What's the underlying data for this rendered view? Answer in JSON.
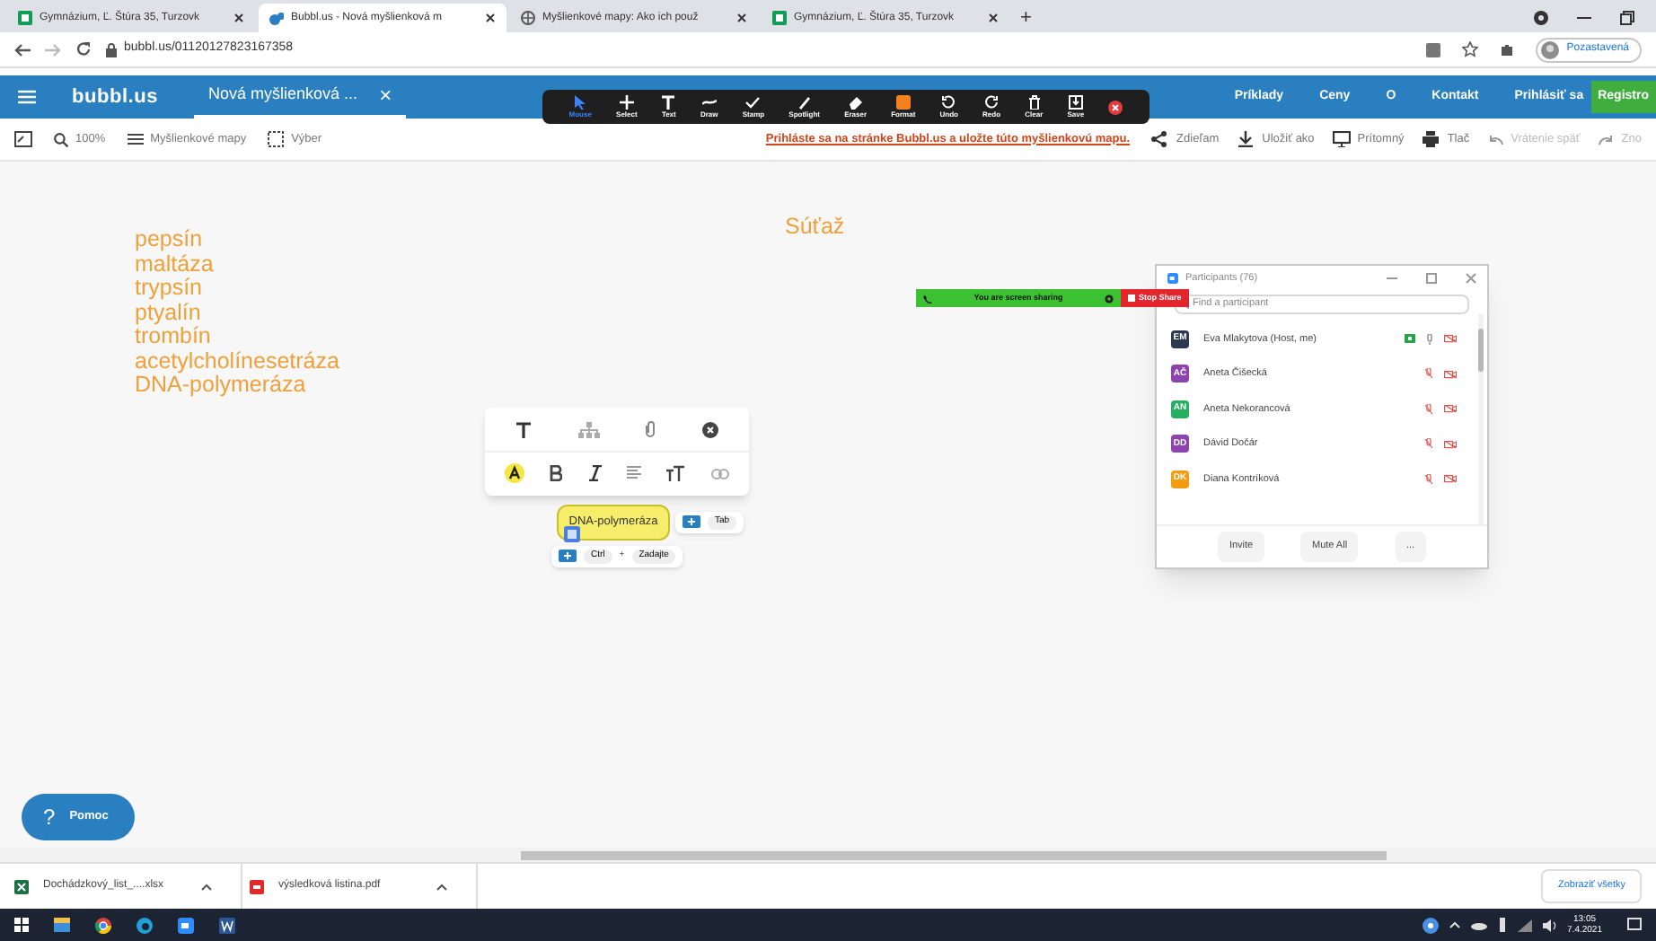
{
  "browser_tabs": [
    {
      "title": "Gymnázium, Ľ. Štúra 35, Turzovk",
      "kind": "sheet",
      "selected": false
    },
    {
      "title": "Bubbl.us - Nová myšlienková m",
      "kind": "bubbl",
      "selected": true
    },
    {
      "title": "Myšlienkové mapy: Ako ich použ",
      "kind": "globe",
      "selected": false
    },
    {
      "title": "Gymnázium, Ľ. Štúra 35, Turzovk",
      "kind": "sheet",
      "selected": false
    }
  ],
  "new_tab": "+",
  "address_bar": {
    "url": "bubbl.us/01120127823167358",
    "profile": "Pozastavená"
  },
  "app_header": {
    "logo": "bubbl.us",
    "document_tab": "Nová myšlienková ...",
    "close": "×",
    "nav": [
      "Príklady",
      "Ceny",
      "O",
      "Kontakt",
      "Prihlásiť sa"
    ],
    "register": "Registro"
  },
  "zoom_toolbar": [
    {
      "label": "Mouse",
      "selected": true
    },
    {
      "label": "Select",
      "selected": false
    },
    {
      "label": "Text",
      "selected": false
    },
    {
      "label": "Draw",
      "selected": false
    },
    {
      "label": "Stamp",
      "selected": false
    },
    {
      "label": "Spotlight",
      "selected": false
    },
    {
      "label": "Eraser",
      "selected": false
    },
    {
      "label": "Format",
      "selected": false
    },
    {
      "label": "Undo",
      "selected": false
    },
    {
      "label": "Redo",
      "selected": false
    },
    {
      "label": "Clear",
      "selected": false
    },
    {
      "label": "Save",
      "selected": false
    }
  ],
  "toolbar": {
    "zoom": "100%",
    "maps": "Myšlienkové mapy",
    "select": "Výber",
    "banner": "Prihláste sa na stránke Bubbl.us a uložte túto myšlienkovú mapu.",
    "actions": [
      "Zdieľam",
      "Uložiť ako",
      "Prítomný",
      "Tlač"
    ],
    "undo": "Vrátenie späť",
    "redo": "Zno"
  },
  "canvas": {
    "list": [
      "pepsín",
      "maltáza",
      "trypsín",
      "ptyalín",
      "trombín",
      "acetylcholínesetráza",
      "DNA-polymeráza"
    ],
    "title": "Súťaž",
    "node": {
      "text": "DNA-polymeráza",
      "tab_hint": "Tab",
      "ctrl_hint": "Ctrl",
      "plus": "+",
      "enter_hint": "Zadajte"
    }
  },
  "screen_share_bar": {
    "label": "You are screen sharing",
    "stop": "Stop Share"
  },
  "participants": {
    "title": "Participants (76)",
    "search_placeholder": "Find a participant",
    "people": [
      {
        "initials": "EM",
        "name": "Eva Mlakytova (Host, me)",
        "color": "#2d3a4e",
        "muted": false
      },
      {
        "initials": "AČ",
        "name": "Aneta Čišecká",
        "color": "#8e44ad",
        "muted": true
      },
      {
        "initials": "AN",
        "name": "Aneta Nekorancová",
        "color": "#27ae60",
        "muted": true
      },
      {
        "initials": "DD",
        "name": "Dávid Dočár",
        "color": "#8e44ad",
        "muted": true
      },
      {
        "initials": "DK",
        "name": "Diana Kontríková",
        "color": "#f39c12",
        "muted": true
      }
    ],
    "buttons": [
      "Invite",
      "Mute All",
      "..."
    ]
  },
  "help": {
    "mark": "?",
    "label": "Pomoc"
  },
  "downloads": {
    "files": [
      {
        "name": "Dochádzkový_list_....xlsx",
        "kind": "excel"
      },
      {
        "name": "výsledková listina.pdf",
        "kind": "pdf"
      }
    ],
    "show_all": "Zobraziť všetky"
  },
  "taskbar": {
    "time": "13:05",
    "date": "7.4.2021"
  }
}
